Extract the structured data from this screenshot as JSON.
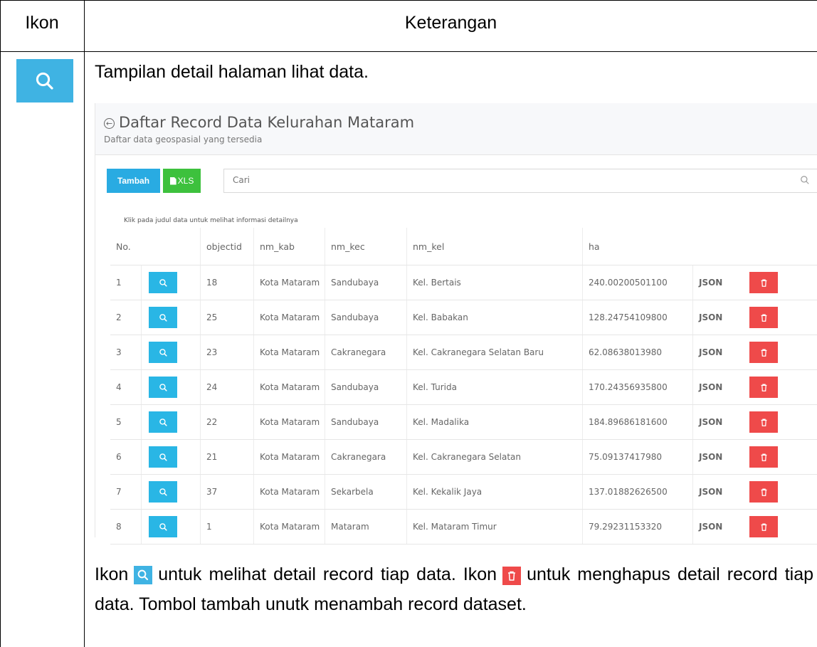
{
  "doc": {
    "col_ikon": "Ikon",
    "col_keterangan": "Keterangan",
    "intro": "Tampilan detail halaman lihat data.",
    "desc_part1": "Ikon",
    "desc_part2": "untuk melihat detail record tiap data. Ikon",
    "desc_part3": "untuk menghapus detail record tiap data. Tombol tambah unutk menambah record dataset."
  },
  "screen": {
    "title": "Daftar Record Data Kelurahan Mataram",
    "subtitle": "Daftar data geospasial yang tersedia",
    "add_label": "Tambah",
    "xls_label": "XLS",
    "search_placeholder": "Cari",
    "hint": "Klik pada judul data untuk melihat informasi detailnya",
    "columns": [
      "No.",
      "objectid",
      "nm_kab",
      "nm_kec",
      "nm_kel",
      "ha"
    ],
    "json_label": "JSON",
    "rows": [
      {
        "no": "1",
        "objectid": "18",
        "kab": "Kota Mataram",
        "kec": "Sandubaya",
        "kel": "Kel. Bertais",
        "ha": "240.00200501100"
      },
      {
        "no": "2",
        "objectid": "25",
        "kab": "Kota Mataram",
        "kec": "Sandubaya",
        "kel": "Kel. Babakan",
        "ha": "128.24754109800"
      },
      {
        "no": "3",
        "objectid": "23",
        "kab": "Kota Mataram",
        "kec": "Cakranegara",
        "kel": "Kel. Cakranegara Selatan Baru",
        "ha": "62.08638013980"
      },
      {
        "no": "4",
        "objectid": "24",
        "kab": "Kota Mataram",
        "kec": "Sandubaya",
        "kel": "Kel. Turida",
        "ha": "170.24356935800"
      },
      {
        "no": "5",
        "objectid": "22",
        "kab": "Kota Mataram",
        "kec": "Sandubaya",
        "kel": "Kel. Madalika",
        "ha": "184.89686181600"
      },
      {
        "no": "6",
        "objectid": "21",
        "kab": "Kota Mataram",
        "kec": "Cakranegara",
        "kel": "Kel. Cakranegara Selatan",
        "ha": "75.09137417980"
      },
      {
        "no": "7",
        "objectid": "37",
        "kab": "Kota Mataram",
        "kec": "Sekarbela",
        "kel": "Kel. Kekalik Jaya",
        "ha": "137.01882626500"
      },
      {
        "no": "8",
        "objectid": "1",
        "kab": "Kota Mataram",
        "kec": "Mataram",
        "kel": "Kel. Mataram Timur",
        "ha": "79.29231153320"
      }
    ]
  },
  "colors": {
    "view": "#29b6e5",
    "delete": "#ef4a4a",
    "add": "#29abe2",
    "xls": "#3dc13d",
    "link": "#3a9bd8"
  },
  "icons": {
    "view": "search-icon",
    "delete": "trash-icon",
    "back": "circle-arrow-left-icon",
    "xls": "file-icon"
  }
}
